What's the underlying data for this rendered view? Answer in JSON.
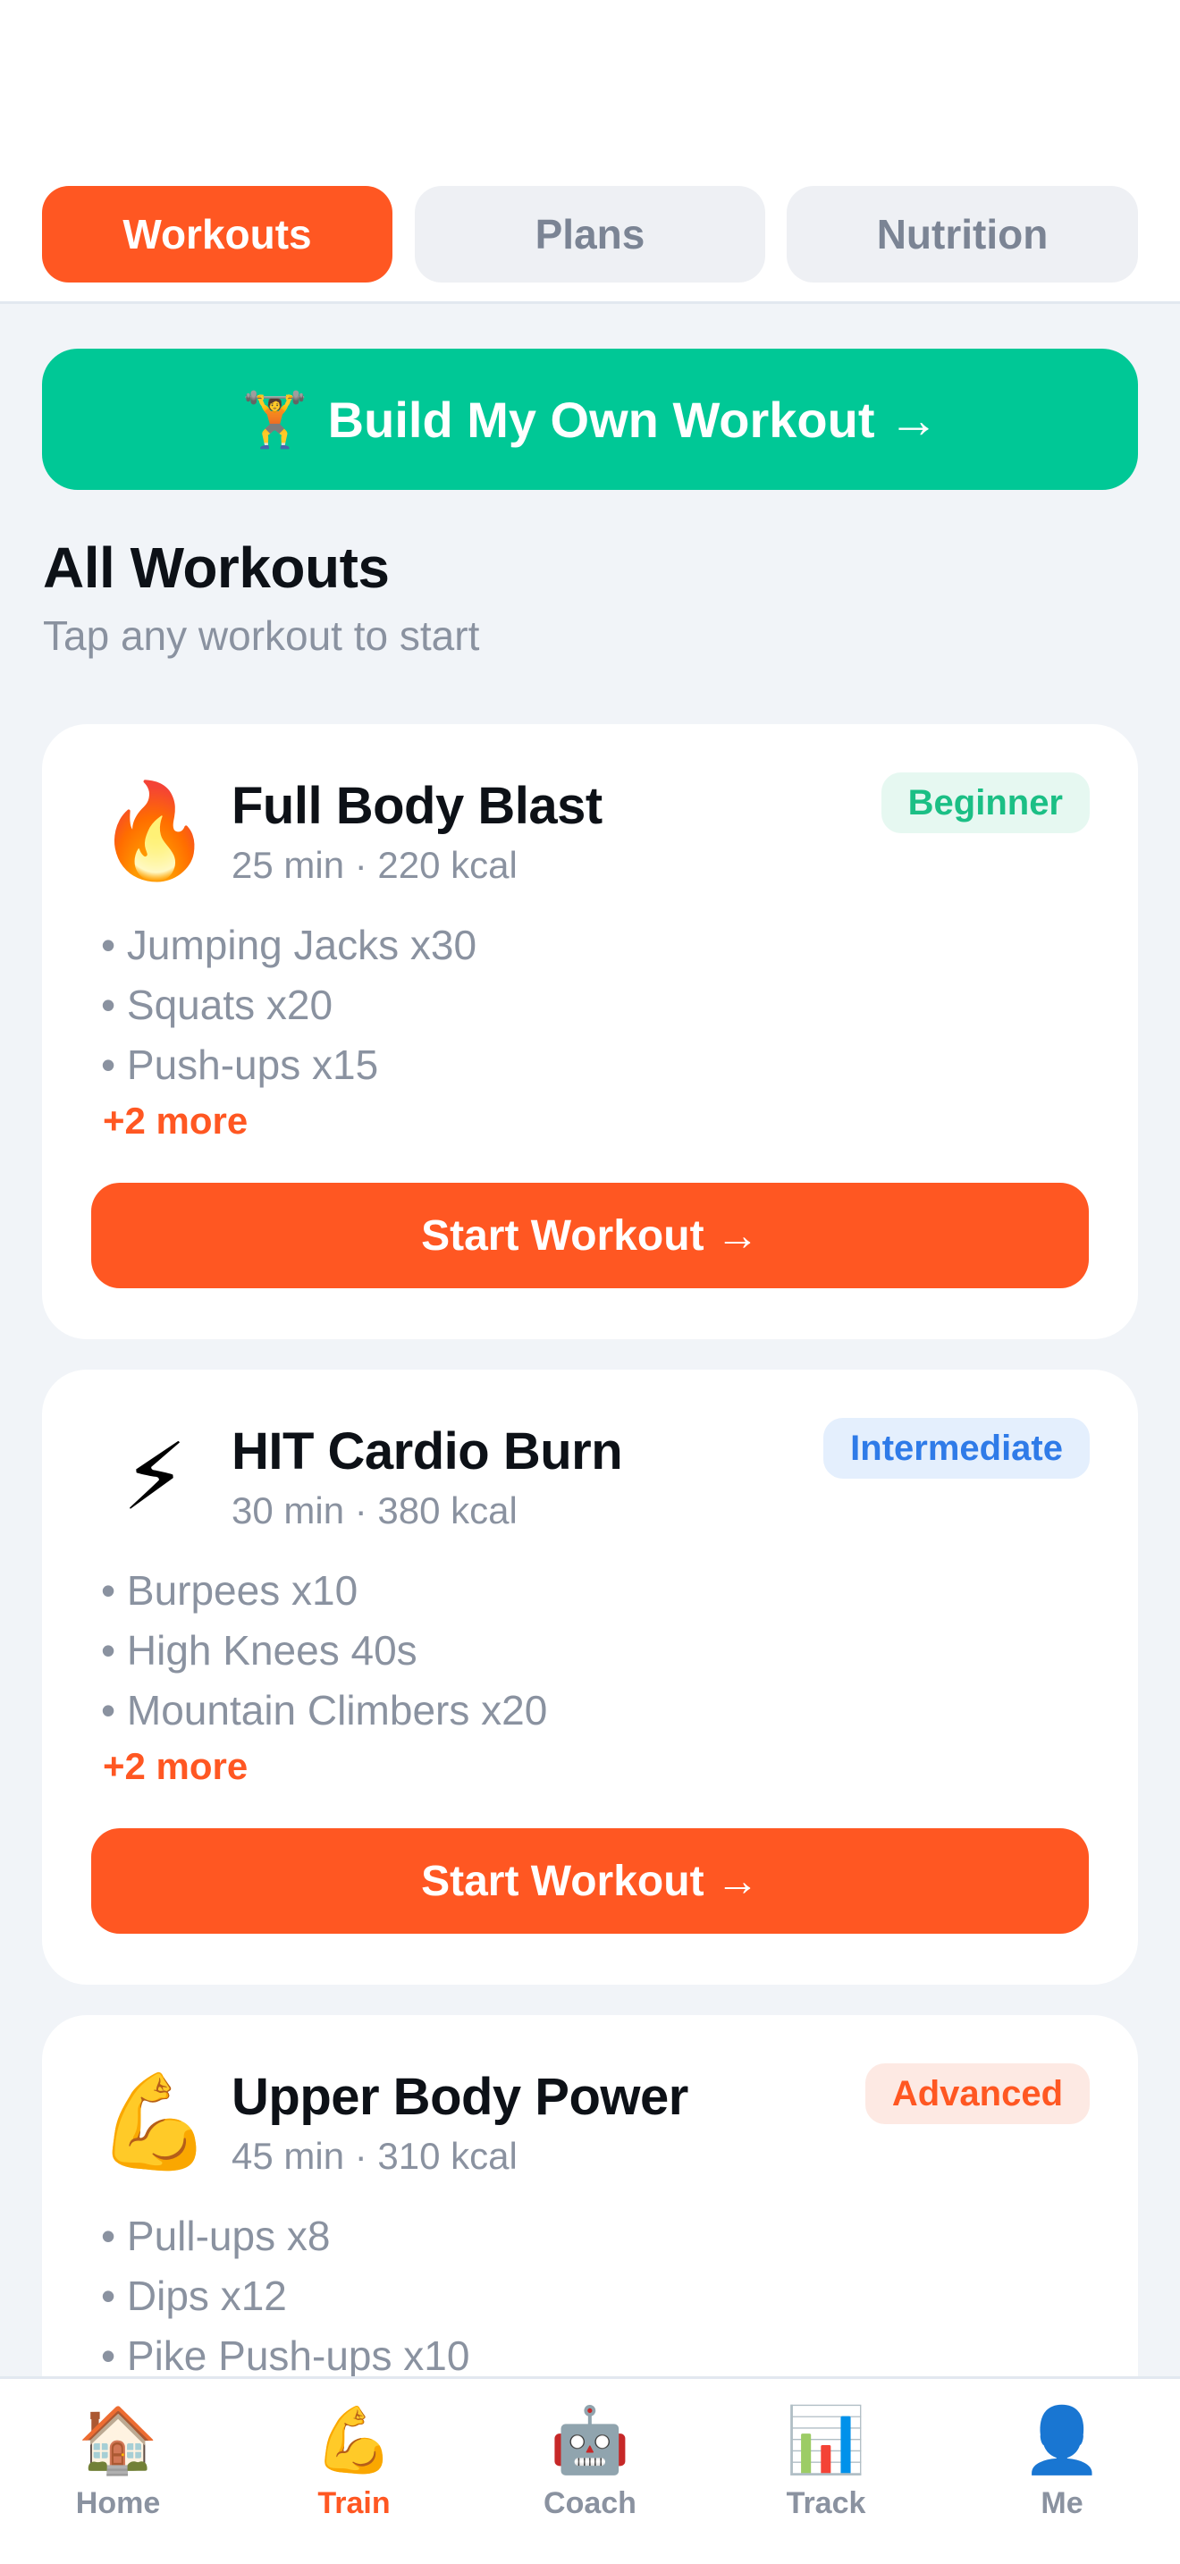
{
  "tabs": [
    {
      "label": "Workouts",
      "active": true
    },
    {
      "label": "Plans",
      "active": false
    },
    {
      "label": "Nutrition",
      "active": false
    }
  ],
  "build_button": {
    "icon": "🏋️",
    "label": "Build My Own Workout →"
  },
  "section": {
    "title": "All Workouts",
    "subtitle": "Tap any workout to start"
  },
  "workouts": [
    {
      "icon": "🔥",
      "title": "Full Body Blast",
      "meta": "25 min · 220 kcal",
      "level": "Beginner",
      "exercises": [
        "• Jumping Jacks x30",
        "• Squats x20",
        "• Push-ups x15"
      ],
      "more": "+2 more",
      "button": "Start Workout →"
    },
    {
      "icon": "⚡",
      "title": "HIT Cardio Burn",
      "meta": "30 min · 380 kcal",
      "level": "Intermediate",
      "exercises": [
        "• Burpees x10",
        "• High Knees 40s",
        "• Mountain Climbers x20"
      ],
      "more": "+2 more",
      "button": "Start Workout →"
    },
    {
      "icon": "💪",
      "title": "Upper Body Power",
      "meta": "45 min · 310 kcal",
      "level": "Advanced",
      "exercises": [
        "• Pull-ups x8",
        "• Dips x12",
        "• Pike Push-ups x10"
      ]
    }
  ],
  "bottom_nav": [
    {
      "icon": "🏠",
      "label": "Home",
      "active": false
    },
    {
      "icon": "💪",
      "label": "Train",
      "active": true
    },
    {
      "icon": "🤖",
      "label": "Coach",
      "active": false
    },
    {
      "icon": "📊",
      "label": "Track",
      "active": false
    },
    {
      "icon": "👤",
      "label": "Me",
      "active": false
    }
  ],
  "colors": {
    "accent": "#ff5722",
    "green": "#00c896",
    "background": "#f1f4f8",
    "muted": "#8a92a0"
  }
}
